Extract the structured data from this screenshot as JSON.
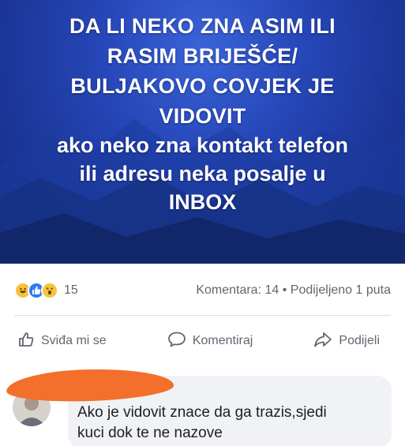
{
  "post": {
    "caps_lines": [
      "DA LI NEKO ZNA ASIM ILI",
      "RASIM BRIJEŠĆE/",
      "BULJAKOVO COVJEK JE",
      "VIDOVIT"
    ],
    "lower_lines": [
      "ako neko zna kontakt telefon",
      "ili adresu neka posalje u",
      "INBOX"
    ],
    "background_color": "#2647b8"
  },
  "stats": {
    "reaction_icons": [
      "haha-icon",
      "like-icon",
      "wow-icon"
    ],
    "reaction_count": "15",
    "comments": "Komentara: 14",
    "separator": "•",
    "shares": "Podijeljeno 1 puta"
  },
  "actions": {
    "like": "Sviđa mi se",
    "comment": "Komentiraj",
    "share": "Podijeli"
  },
  "comment": {
    "text_line1": "Ako je vidovit znace da ga trazis,sjedi",
    "text_line2": "kuci dok te ne nazove"
  }
}
